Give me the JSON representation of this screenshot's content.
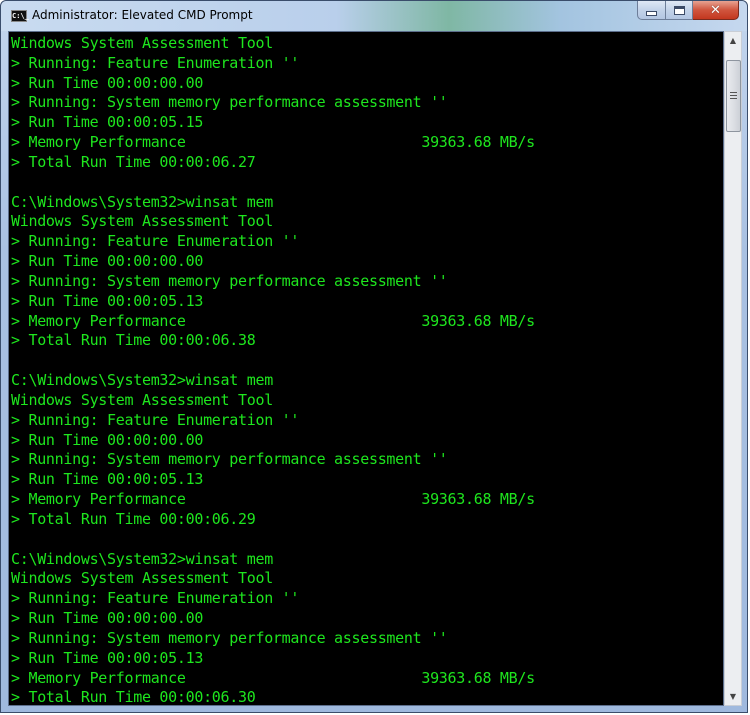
{
  "window": {
    "title": "Administrator: Elevated CMD Prompt",
    "app_icon_text": "C:\\_",
    "buttons": {
      "minimize": "minimize",
      "maximize": "maximize",
      "close": "✕"
    }
  },
  "console": {
    "text_color": "#1ee61e",
    "background": "#000000",
    "lines": [
      "Windows System Assessment Tool",
      "> Running: Feature Enumeration ''",
      "> Run Time 00:00:00.00",
      "> Running: System memory performance assessment ''",
      "> Run Time 00:00:05.15",
      "> Memory Performance                           39363.68 MB/s",
      "> Total Run Time 00:00:06.27",
      "",
      "C:\\Windows\\System32>winsat mem",
      "Windows System Assessment Tool",
      "> Running: Feature Enumeration ''",
      "> Run Time 00:00:00.00",
      "> Running: System memory performance assessment ''",
      "> Run Time 00:00:05.13",
      "> Memory Performance                           39363.68 MB/s",
      "> Total Run Time 00:00:06.38",
      "",
      "C:\\Windows\\System32>winsat mem",
      "Windows System Assessment Tool",
      "> Running: Feature Enumeration ''",
      "> Run Time 00:00:00.00",
      "> Running: System memory performance assessment ''",
      "> Run Time 00:00:05.13",
      "> Memory Performance                           39363.68 MB/s",
      "> Total Run Time 00:00:06.29",
      "",
      "C:\\Windows\\System32>winsat mem",
      "Windows System Assessment Tool",
      "> Running: Feature Enumeration ''",
      "> Run Time 00:00:00.00",
      "> Running: System memory performance assessment ''",
      "> Run Time 00:00:05.13",
      "> Memory Performance                           39363.68 MB/s",
      "> Total Run Time 00:00:06.30"
    ]
  },
  "scrollbar": {
    "up_arrow": "▲",
    "down_arrow": "▼",
    "position_fraction": 0.0
  }
}
